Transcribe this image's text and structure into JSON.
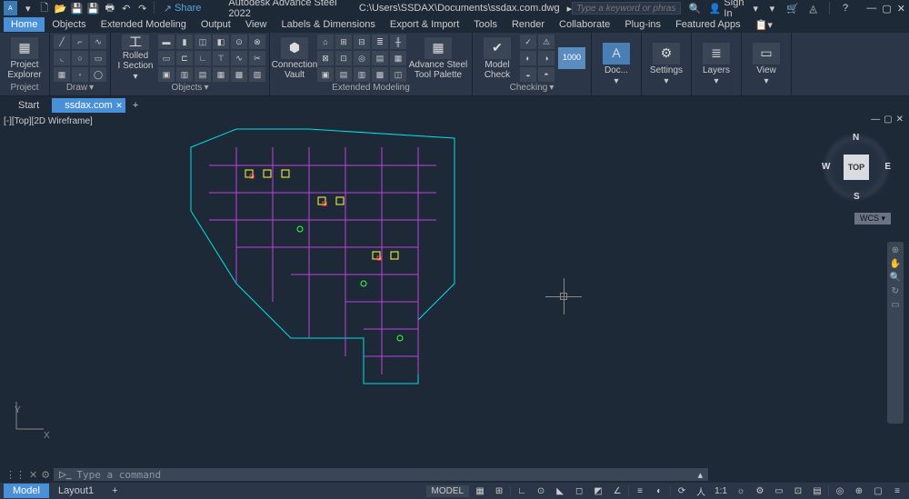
{
  "titlebar": {
    "share": "Share",
    "app_name": "Autodesk Advance Steel 2022",
    "file_path": "C:\\Users\\SSDAX\\Documents\\ssdax.com.dwg",
    "search_placeholder": "Type a keyword or phrase",
    "signin": "Sign In"
  },
  "menus": [
    "Home",
    "Objects",
    "Extended Modeling",
    "Output",
    "View",
    "Labels & Dimensions",
    "Export & Import",
    "Tools",
    "Render",
    "Collaborate",
    "Plug-ins",
    "Featured Apps"
  ],
  "ribbon": {
    "project_explorer": "Project\nExplorer",
    "rolled_section": "Rolled\nI Section",
    "connection_vault": "Connection\nVault",
    "advance_steel_palette": "Advance Steel\nTool Palette",
    "model_check": "Model\nCheck",
    "docs": "Doc...",
    "settings": "Settings",
    "layers": "Layers",
    "view": "View",
    "num1000": "1000",
    "panel_project": "Project",
    "panel_draw": "Draw",
    "panel_objects": "Objects",
    "panel_extended": "Extended Modeling",
    "panel_checking": "Checking"
  },
  "tabs": {
    "start": "Start",
    "file": "ssdax.com"
  },
  "viewport": {
    "label": "[-][Top][2D Wireframe]",
    "cube_top": "TOP",
    "dir_n": "N",
    "dir_s": "S",
    "dir_e": "E",
    "dir_w": "W",
    "wcs": "WCS",
    "ucs_x": "X",
    "ucs_y": "Y"
  },
  "cmd": {
    "placeholder": "Type a command"
  },
  "status": {
    "model": "Model",
    "layout": "Layout1",
    "model_btn": "MODEL",
    "scale": "1:1",
    "zoom_icon": "⚙"
  }
}
